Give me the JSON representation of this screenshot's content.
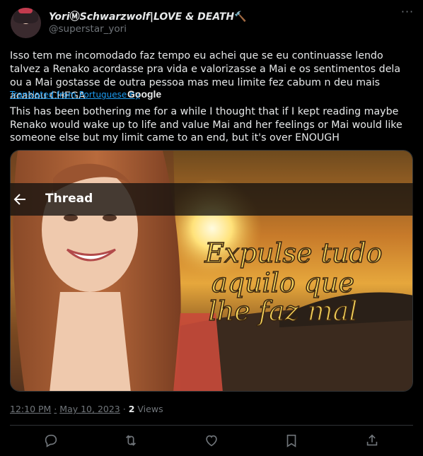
{
  "author": {
    "name_styled": "Yori",
    "name_mid": "Ⓜ",
    "name_rest": "Schwarzwolf|LOVE & DEATH",
    "name_emoji": "🔨",
    "handle": "@superstar_yori"
  },
  "tweet": {
    "text": "Isso tem me incomodado faz tempo eu achei que se eu continuasse lendo talvez a Renako acordasse pra vida e valorizasse a Mai e os sentimentos dela ou a Mai gostasse de outra pessoa mas meu limite fez cabum n deu mais acabou CHEGA",
    "translated_label": "Translated from Portuguese by",
    "translator": "Google",
    "translation": "This has been bothering me for a while I thought that if I kept reading maybe Renako would wake up to life and value Mai and her feelings or Mai would like someone else but my limit came to an end, but it's over ENOUGH"
  },
  "media": {
    "caption_lines": [
      "Expulse tudo",
      "aquilo que",
      "lhe faz mal"
    ]
  },
  "overlay": {
    "title": "Thread"
  },
  "meta": {
    "time": "12:10 PM",
    "separator": "·",
    "date": "May 10, 2023",
    "views_count": "2",
    "views_label": "Views"
  },
  "colors": {
    "background": "#000000",
    "text": "#e7e9ea",
    "muted": "#71767b",
    "link": "#1d9bf0"
  },
  "icons": {
    "more": "more-icon",
    "back": "back-arrow-icon",
    "reply": "reply-icon",
    "retweet": "retweet-icon",
    "like": "like-icon",
    "bookmark": "bookmark-icon",
    "share": "share-icon"
  }
}
